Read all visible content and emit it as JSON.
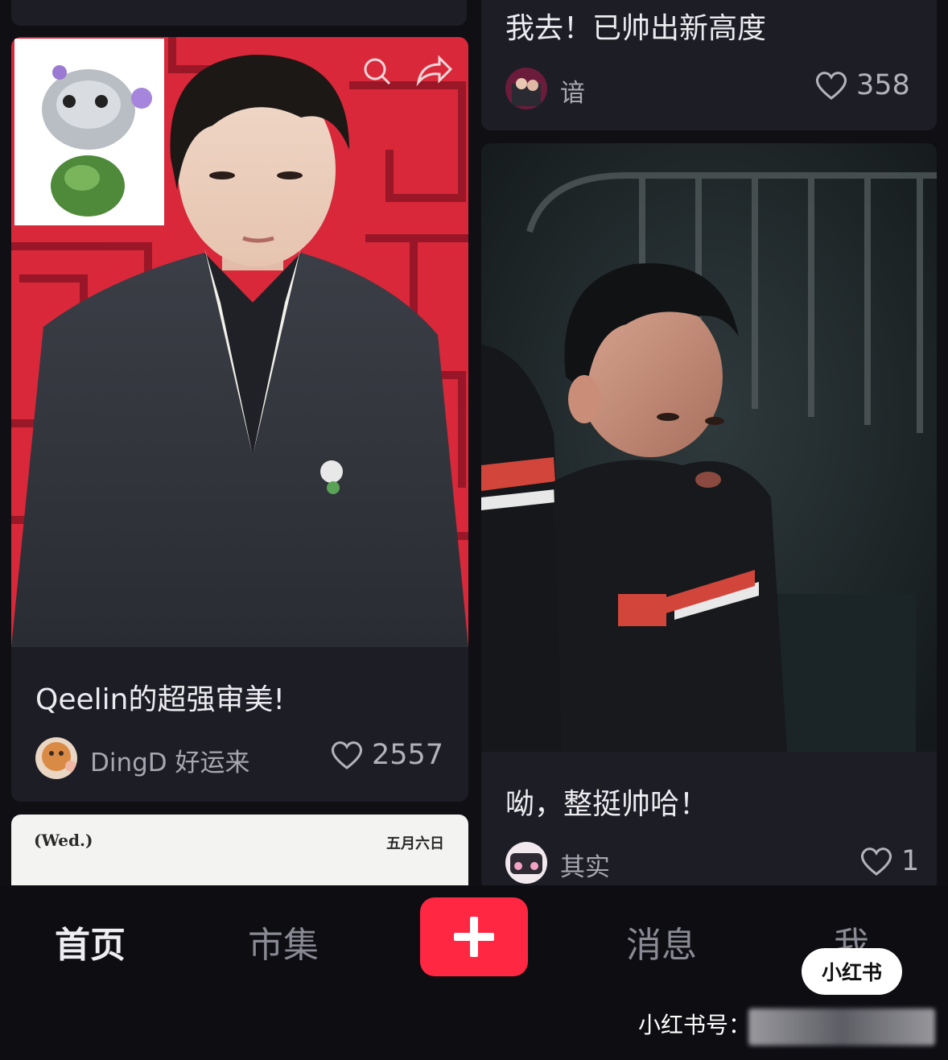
{
  "feed": {
    "left_column": [
      {
        "title": "Qeelin的超强审美!",
        "author": "DingD 好运来",
        "likes": "2557"
      }
    ],
    "right_column": [
      {
        "title": "我去！已帅出新高度",
        "author": "谙",
        "likes": "358"
      },
      {
        "title": "呦，整挺帅哈！",
        "author": "其实",
        "likes": "1"
      }
    ],
    "calendar_card": {
      "day": "(Wed.)",
      "date": "五月六日"
    }
  },
  "tabbar": {
    "tabs": [
      "首页",
      "市集",
      "消息",
      "我"
    ],
    "active_tab": "首页"
  },
  "watermark": {
    "brand": "小红书",
    "id_label": "小红书号："
  },
  "colors": {
    "background": "#0f0f14",
    "card": "#1d1d25",
    "accent_red": "#ff2742"
  },
  "icons": [
    "search-icon",
    "share-icon",
    "heart-icon",
    "plus-icon"
  ]
}
